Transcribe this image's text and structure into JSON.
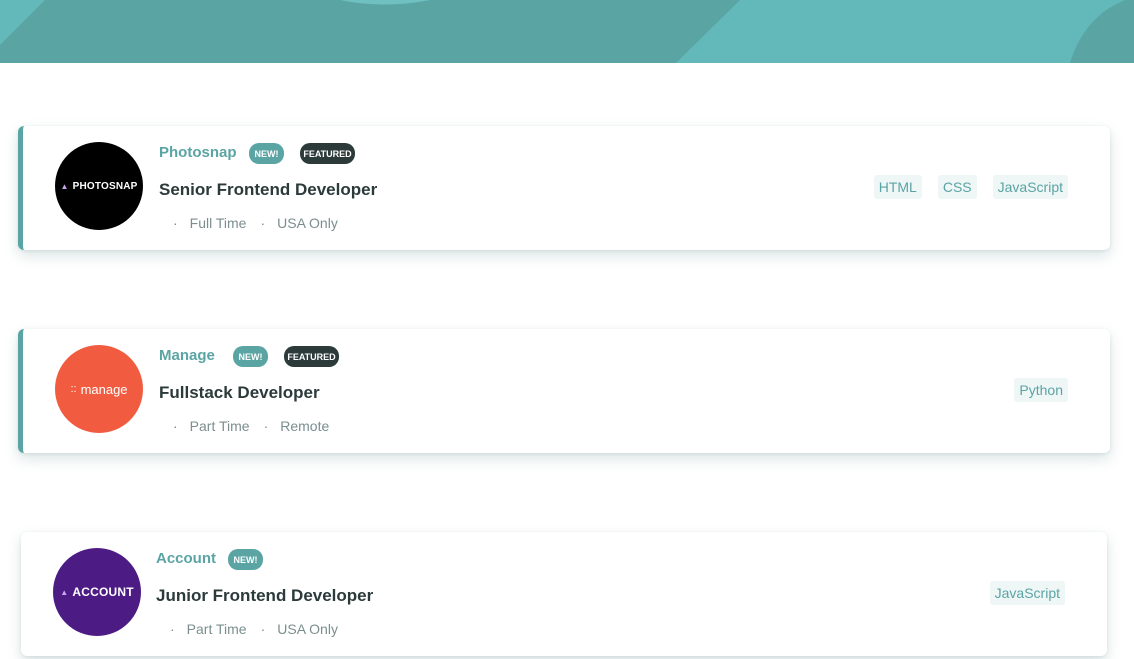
{
  "colors": {
    "primary": "#5ba4a4",
    "dark": "#2c3a3a",
    "muted": "#7b8e8e",
    "tag_bg": "#eef6f6",
    "header_bg": "#5ba4a4"
  },
  "jobs": [
    {
      "logo_text": "PHOTOSNAP",
      "logo_color": "#000000",
      "company": "Photosnap",
      "new_label": "NEW!",
      "featured_label": "FEATURED",
      "position": "Senior Frontend Developer",
      "contract": "Full Time",
      "location": "USA Only",
      "tags": [
        "HTML",
        "CSS",
        "JavaScript"
      ]
    },
    {
      "logo_text": "manage",
      "logo_color": "#f15c41",
      "company": "Manage",
      "new_label": "NEW!",
      "featured_label": "FEATURED",
      "position": "Fullstack Developer",
      "contract": "Part Time",
      "location": "Remote",
      "tags": [
        "Python"
      ]
    },
    {
      "logo_text": "ACCOUNT",
      "logo_color": "#4c1c84",
      "company": "Account",
      "new_label": "NEW!",
      "position": "Junior Frontend Developer",
      "contract": "Part Time",
      "location": "USA Only",
      "tags": [
        "JavaScript"
      ]
    }
  ]
}
